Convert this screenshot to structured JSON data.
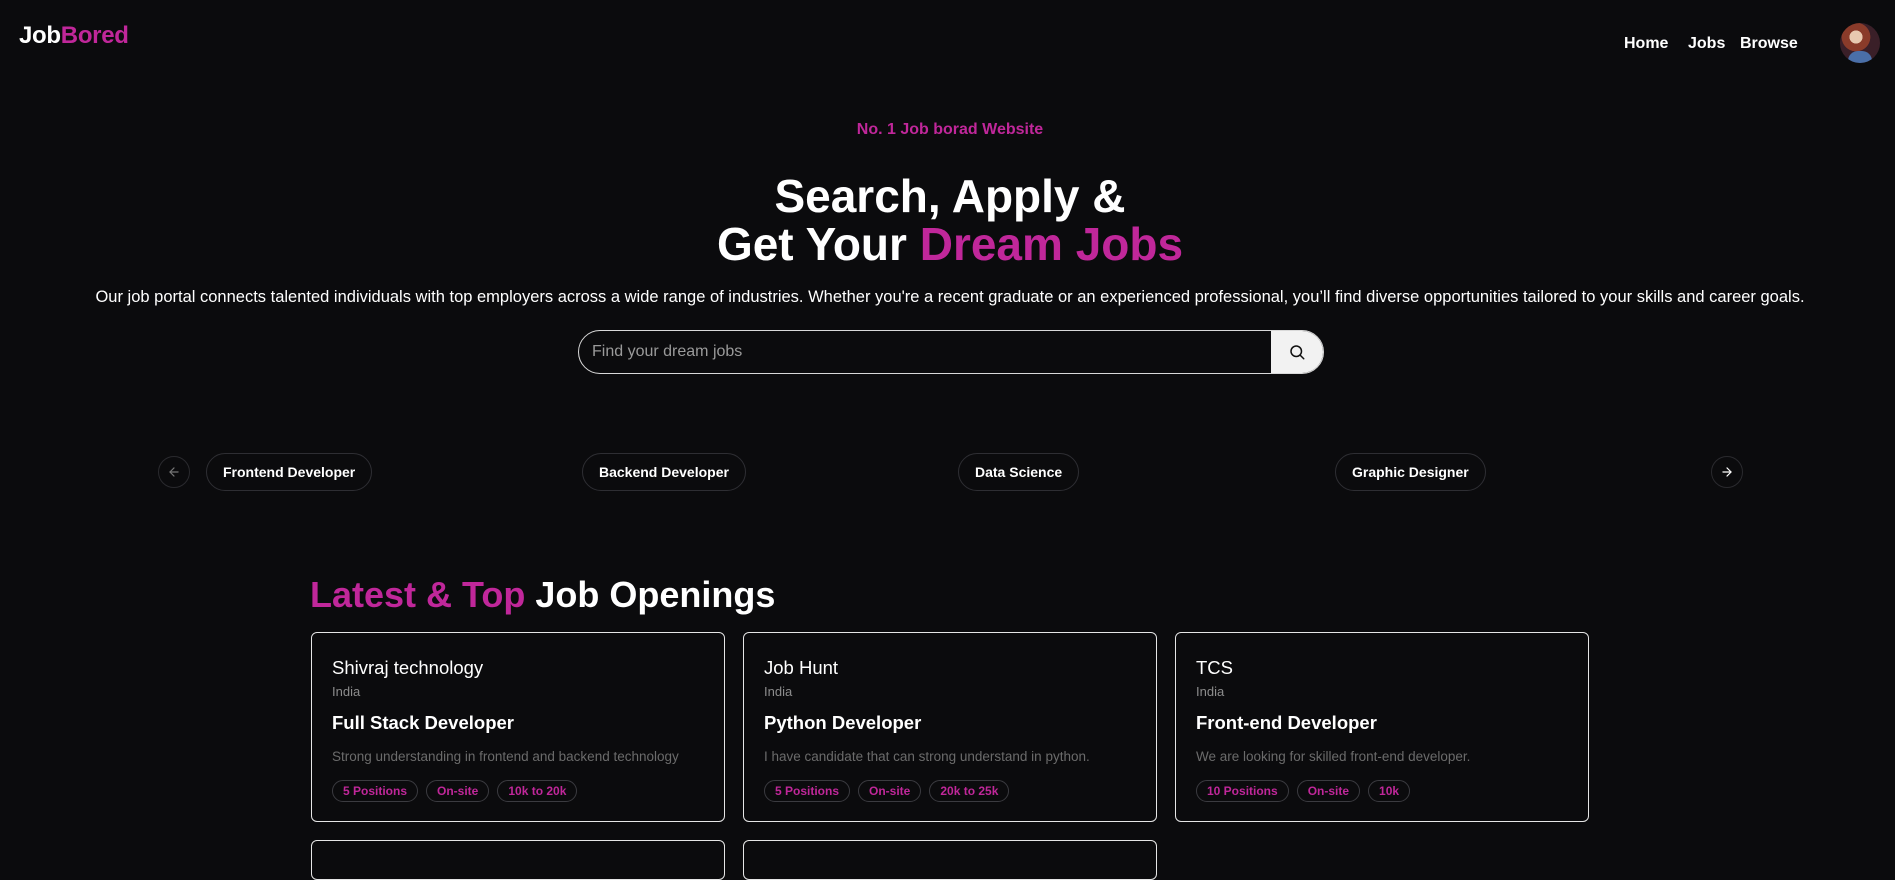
{
  "brand": {
    "part1": "Job",
    "part2": "Bored",
    "accent": "#c0279a"
  },
  "nav": {
    "home": "Home",
    "jobs": "Jobs",
    "browse": "Browse"
  },
  "hero": {
    "tagline": "No. 1 Job borad Website",
    "headline_line1": "Search, Apply &",
    "headline_line2_pre": "Get Your ",
    "headline_line2_accent": "Dream Jobs",
    "description": "Our job portal connects talented individuals with top employers across a wide range of industries. Whether you're a recent graduate or an experienced professional, you’ll find diverse opportunities tailored to your skills and career goals."
  },
  "search": {
    "placeholder": "Find your dream jobs",
    "value": "",
    "icon": "search-icon"
  },
  "categories": {
    "prev_icon": "arrow-left-icon",
    "next_icon": "arrow-right-icon",
    "items": [
      "Frontend Developer",
      "Backend Developer",
      "Data Science",
      "Graphic Designer"
    ]
  },
  "latest": {
    "title_accent": "Latest & Top",
    "title_rest": " Job Openings",
    "jobs": [
      {
        "company": "Shivraj technology",
        "location": "India",
        "title": "Full Stack Developer",
        "description": "Strong understanding in frontend and backend technology",
        "positions": "5 Positions",
        "type": "On-site",
        "salary": "10k to 20k"
      },
      {
        "company": "Job Hunt",
        "location": "India",
        "title": "Python Developer",
        "description": "I have candidate that can strong understand in python.",
        "positions": "5 Positions",
        "type": "On-site",
        "salary": "20k to 25k"
      },
      {
        "company": "TCS",
        "location": "India",
        "title": "Front-end Developer",
        "description": "We are looking for skilled front-end developer.",
        "positions": "10 Positions",
        "type": "On-site",
        "salary": "10k"
      }
    ]
  }
}
